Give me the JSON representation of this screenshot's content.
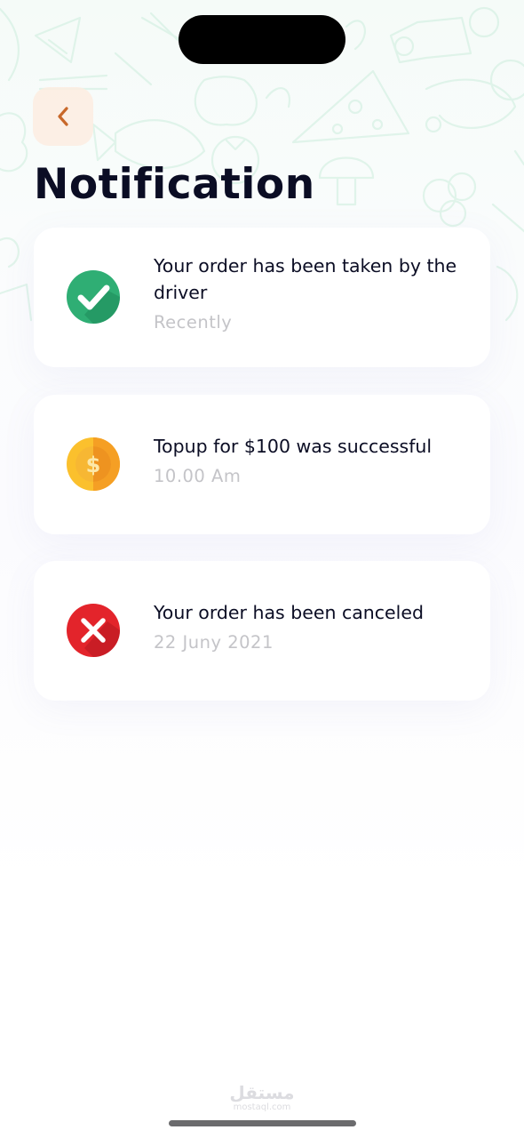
{
  "header": {
    "title": "Notification",
    "back_icon": "chevron-left-icon"
  },
  "notifications": [
    {
      "icon": "check-circle-icon",
      "title": "Your order has been taken by the driver",
      "time": "Recently",
      "color": "#2fae74"
    },
    {
      "icon": "coin-dollar-icon",
      "title": "Topup for $100 was successful",
      "time": "10.00 Am",
      "color": "#fbc02d"
    },
    {
      "icon": "x-circle-icon",
      "title": "Your order has been canceled",
      "time": "22 Juny 2021",
      "color": "#e3242b"
    }
  ],
  "watermark": {
    "arabic": "مستقل",
    "latin": "mostaql.com"
  },
  "colors": {
    "accent": "#c8682a",
    "back_button_bg": "#fdece0",
    "title": "#0b0d24",
    "muted": "#c4c4c8"
  }
}
